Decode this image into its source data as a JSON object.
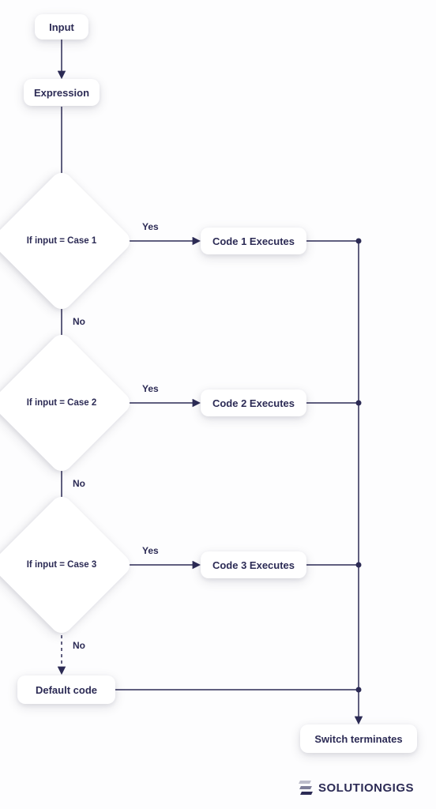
{
  "nodes": {
    "input": "Input",
    "expression": "Expression",
    "case1": "If input = Case 1",
    "case2": "If input = Case 2",
    "case3": "If input = Case 3",
    "code1": "Code 1 Executes",
    "code2": "Code 2 Executes",
    "code3": "Code 3 Executes",
    "default": "Default code",
    "terminate": "Switch terminates"
  },
  "labels": {
    "yes": "Yes",
    "no": "No"
  },
  "brand": "SOLUTIONGIGS",
  "colors": {
    "line": "#2c2b55",
    "text": "#2c2b55",
    "node_bg": "#ffffff"
  }
}
